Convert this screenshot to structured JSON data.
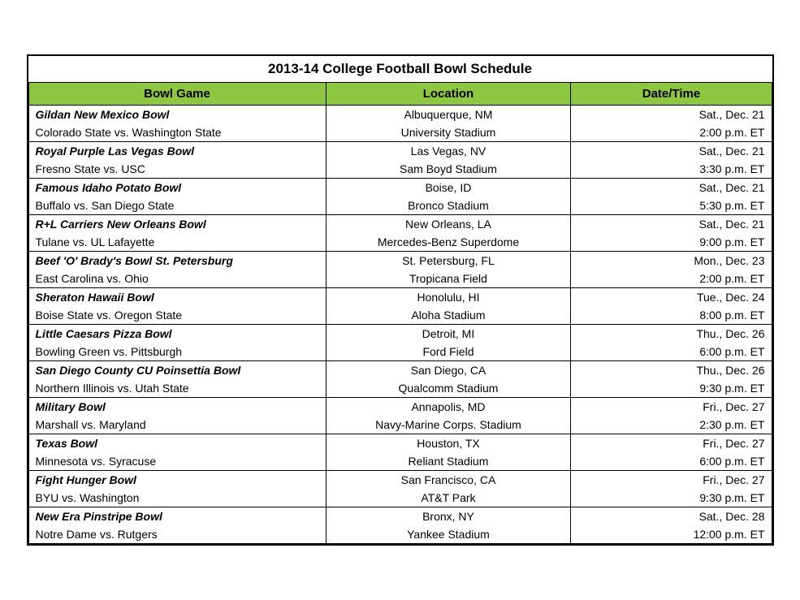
{
  "title": "2013-14 College Football Bowl Schedule",
  "headers": {
    "bowl": "Bowl Game",
    "location": "Location",
    "datetime": "Date/Time"
  },
  "games": [
    {
      "name": "Gildan New Mexico Bowl",
      "matchup": "Colorado State vs. Washington State",
      "city": "Albuquerque, NM",
      "stadium": "University Stadium",
      "date": "Sat., Dec. 21",
      "time": "2:00 p.m. ET"
    },
    {
      "name": "Royal Purple Las Vegas Bowl",
      "matchup": "Fresno State vs. USC",
      "city": "Las Vegas, NV",
      "stadium": "Sam Boyd Stadium",
      "date": "Sat., Dec. 21",
      "time": "3:30 p.m. ET"
    },
    {
      "name": "Famous Idaho Potato Bowl",
      "matchup": "Buffalo vs. San Diego State",
      "city": "Boise, ID",
      "stadium": "Bronco Stadium",
      "date": "Sat., Dec. 21",
      "time": "5:30 p.m. ET"
    },
    {
      "name": "R+L Carriers New Orleans Bowl",
      "matchup": "Tulane vs. UL Lafayette",
      "city": "New Orleans, LA",
      "stadium": "Mercedes-Benz Superdome",
      "date": "Sat., Dec. 21",
      "time": "9:00 p.m. ET"
    },
    {
      "name": "Beef 'O' Brady's Bowl St. Petersburg",
      "matchup": "East Carolina vs. Ohio",
      "city": "St. Petersburg, FL",
      "stadium": "Tropicana Field",
      "date": "Mon., Dec. 23",
      "time": "2:00 p.m. ET"
    },
    {
      "name": "Sheraton Hawaii Bowl",
      "matchup": "Boise State vs. Oregon State",
      "city": "Honolulu, HI",
      "stadium": "Aloha Stadium",
      "date": "Tue., Dec. 24",
      "time": "8:00 p.m. ET"
    },
    {
      "name": "Little Caesars Pizza Bowl",
      "matchup": "Bowling Green vs. Pittsburgh",
      "city": "Detroit, MI",
      "stadium": "Ford Field",
      "date": "Thu., Dec. 26",
      "time": "6:00 p.m. ET"
    },
    {
      "name": "San Diego County CU Poinsettia Bowl",
      "matchup": "Northern Illinois vs. Utah State",
      "city": "San Diego, CA",
      "stadium": "Qualcomm Stadium",
      "date": "Thu., Dec. 26",
      "time": "9:30 p.m. ET"
    },
    {
      "name": "Military Bowl",
      "matchup": "Marshall vs. Maryland",
      "city": "Annapolis, MD",
      "stadium": "Navy-Marine Corps. Stadium",
      "date": "Fri., Dec. 27",
      "time": "2:30 p.m. ET"
    },
    {
      "name": "Texas Bowl",
      "matchup": "Minnesota vs. Syracuse",
      "city": "Houston, TX",
      "stadium": "Reliant Stadium",
      "date": "Fri., Dec. 27",
      "time": "6:00 p.m. ET"
    },
    {
      "name": "Fight Hunger Bowl",
      "matchup": "BYU vs. Washington",
      "city": "San Francisco, CA",
      "stadium": "AT&T Park",
      "date": "Fri., Dec. 27",
      "time": "9:30 p.m. ET"
    },
    {
      "name": "New Era Pinstripe Bowl",
      "matchup": "Notre Dame vs. Rutgers",
      "city": "Bronx, NY",
      "stadium": "Yankee Stadium",
      "date": "Sat., Dec. 28",
      "time": "12:00 p.m. ET"
    }
  ]
}
